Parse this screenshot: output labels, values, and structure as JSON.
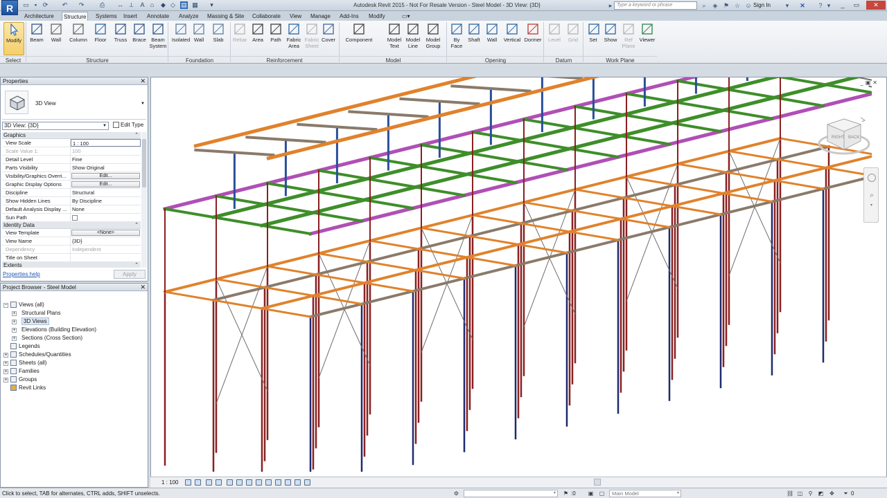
{
  "app": {
    "logo": "R",
    "title": "Autodesk Revit 2015 -   Not For Resale Version  -  Steel Model - 3D View: {3D}"
  },
  "search": {
    "placeholder": "Type a keyword or phrase"
  },
  "user": {
    "signin": "Sign In"
  },
  "ribbon_tabs": [
    "Architecture",
    "Structure",
    "Systems",
    "Insert",
    "Annotate",
    "Analyze",
    "Massing & Site",
    "Collaborate",
    "View",
    "Manage",
    "Add-Ins",
    "Modify"
  ],
  "active_tab": "Structure",
  "ribbon": {
    "buttons": [
      {
        "label": "Modify",
        "icon": "cursor-icon",
        "enabled": true
      },
      {
        "label": "Beam",
        "icon": "beam-icon",
        "enabled": true
      },
      {
        "label": "Wall",
        "icon": "wall-icon",
        "enabled": true
      },
      {
        "label": "Column",
        "icon": "column-icon",
        "enabled": true
      },
      {
        "label": "Floor",
        "icon": "floor-icon",
        "enabled": true
      },
      {
        "label": "Truss",
        "icon": "truss-icon",
        "enabled": true
      },
      {
        "label": "Brace",
        "icon": "brace-icon",
        "enabled": true
      },
      {
        "label": "Beam System",
        "icon": "beam-system-icon",
        "enabled": true
      },
      {
        "label": "Isolated",
        "icon": "isolated-footing-icon",
        "enabled": true
      },
      {
        "label": "Wall",
        "icon": "wall-footing-icon",
        "enabled": true
      },
      {
        "label": "Slab",
        "icon": "slab-icon",
        "enabled": true
      },
      {
        "label": "Rebar",
        "icon": "rebar-icon",
        "enabled": false
      },
      {
        "label": "Area",
        "icon": "area-reinforcement-icon",
        "enabled": true
      },
      {
        "label": "Path",
        "icon": "path-reinforcement-icon",
        "enabled": true
      },
      {
        "label": "Fabric Area",
        "icon": "fabric-area-icon",
        "enabled": true
      },
      {
        "label": "Fabric Sheet",
        "icon": "fabric-sheet-icon",
        "enabled": false
      },
      {
        "label": "Cover",
        "icon": "cover-icon",
        "enabled": true
      },
      {
        "label": "Component",
        "icon": "component-icon",
        "enabled": true
      },
      {
        "label": "Model Text",
        "icon": "model-text-icon",
        "enabled": true
      },
      {
        "label": "Model Line",
        "icon": "model-line-icon",
        "enabled": true
      },
      {
        "label": "Model Group",
        "icon": "model-group-icon",
        "enabled": true
      },
      {
        "label": "By Face",
        "icon": "by-face-icon",
        "enabled": true
      },
      {
        "label": "Shaft",
        "icon": "shaft-icon",
        "enabled": true
      },
      {
        "label": "Wall",
        "icon": "wall-opening-icon",
        "enabled": true
      },
      {
        "label": "Vertical",
        "icon": "vertical-opening-icon",
        "enabled": true
      },
      {
        "label": "Dormer",
        "icon": "dormer-icon",
        "enabled": true
      },
      {
        "label": "Level",
        "icon": "level-icon",
        "enabled": false
      },
      {
        "label": "Grid",
        "icon": "grid-icon",
        "enabled": false
      },
      {
        "label": "Set",
        "icon": "set-workplane-icon",
        "enabled": true
      },
      {
        "label": "Show",
        "icon": "show-workplane-icon",
        "enabled": true
      },
      {
        "label": "Ref Plane",
        "icon": "ref-plane-icon",
        "enabled": false
      },
      {
        "label": "Viewer",
        "icon": "viewer-icon",
        "enabled": true
      }
    ],
    "panels": [
      "Select",
      "Structure",
      "Foundation",
      "Reinforcement",
      "Model",
      "Opening",
      "Datum",
      "Work Plane"
    ]
  },
  "properties": {
    "header": "Properties",
    "type_label": "3D View",
    "instance_selector": "3D View: {3D}",
    "edit_type": "Edit Type",
    "groups": [
      {
        "name": "Graphics",
        "rows": [
          {
            "k": "View Scale",
            "v": "1 : 100",
            "kind": "boxed"
          },
          {
            "k": "Scale Value    1:",
            "v": "100",
            "kind": "gray"
          },
          {
            "k": "Detail Level",
            "v": "Fine"
          },
          {
            "k": "Parts Visibility",
            "v": "Show Original"
          },
          {
            "k": "Visibility/Graphics Overri...",
            "v": "Edit...",
            "kind": "button"
          },
          {
            "k": "Graphic Display Options",
            "v": "Edit...",
            "kind": "button"
          },
          {
            "k": "Discipline",
            "v": "Structural"
          },
          {
            "k": "Show Hidden Lines",
            "v": "By Discipline"
          },
          {
            "k": "Default Analysis Display ...",
            "v": "None"
          },
          {
            "k": "Sun Path",
            "v": "",
            "kind": "checkbox"
          }
        ]
      },
      {
        "name": "Identity Data",
        "rows": [
          {
            "k": "View Template",
            "v": "<None>",
            "kind": "button"
          },
          {
            "k": "View Name",
            "v": "{3D}"
          },
          {
            "k": "Dependency",
            "v": "Independent",
            "kind": "gray"
          },
          {
            "k": "Title on Sheet",
            "v": ""
          }
        ]
      },
      {
        "name": "Extents",
        "rows": []
      }
    ],
    "help": "Properties help",
    "apply": "Apply"
  },
  "browser": {
    "header": "Project Browser - Steel Model",
    "items": [
      {
        "label": "Views (all)",
        "level": 0,
        "exp": "−",
        "icon": "views-icon"
      },
      {
        "label": "Structural Plans",
        "level": 1,
        "exp": "+"
      },
      {
        "label": "3D Views",
        "level": 1,
        "exp": "+",
        "selected": true
      },
      {
        "label": "Elevations (Building Elevation)",
        "level": 1,
        "exp": "+"
      },
      {
        "label": "Sections (Cross Section)",
        "level": 1,
        "exp": "+"
      },
      {
        "label": "Legends",
        "level": 0,
        "exp": "",
        "icon": "legend-icon"
      },
      {
        "label": "Schedules/Quantities",
        "level": 0,
        "exp": "+",
        "icon": "schedule-icon"
      },
      {
        "label": "Sheets (all)",
        "level": 0,
        "exp": "+",
        "icon": "sheet-icon"
      },
      {
        "label": "Families",
        "level": 0,
        "exp": "+",
        "icon": "family-icon"
      },
      {
        "label": "Groups",
        "level": 0,
        "exp": "+",
        "icon": "group-icon"
      },
      {
        "label": "Revit Links",
        "level": 0,
        "exp": "",
        "icon": "link-icon"
      }
    ]
  },
  "viewport": {
    "scale": "1 : 100",
    "viewcube": {
      "right": "RIGHT",
      "back": "BACK"
    },
    "colors": {
      "roof_beam": "#e0822c",
      "beam_brown": "#8a7a6a",
      "purple": "#b04fb5",
      "green": "#3e8e2a",
      "column_blue": "#2a4f9a",
      "column_red": "#8a2020",
      "column_navy": "#1f2a6e",
      "brace": "#6c6c6c"
    }
  },
  "status": {
    "message": "Click to select, TAB for alternates, CTRL adds, SHIFT unselects.",
    "zero": ":0",
    "model": "Main Model",
    "filter_count": "0"
  }
}
